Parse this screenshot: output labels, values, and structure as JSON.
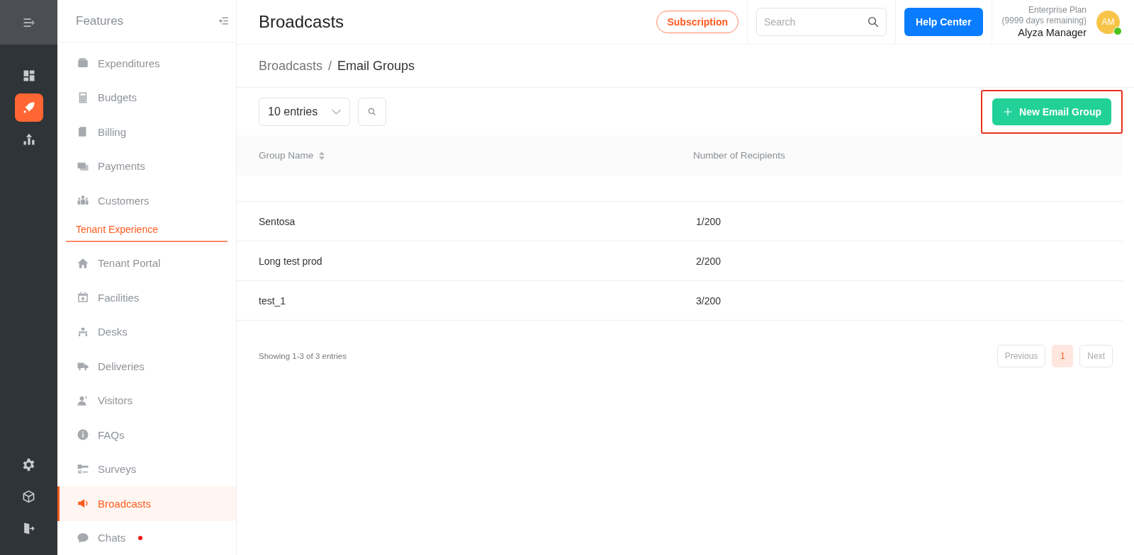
{
  "rail": {
    "items": [
      {
        "selected": false
      },
      {
        "selected": true
      },
      {
        "selected": false
      }
    ],
    "bottom_items": [
      {
        "kind": "settings"
      },
      {
        "kind": "package"
      },
      {
        "kind": "logout"
      }
    ]
  },
  "sidebar": {
    "title": "Features",
    "items": [
      {
        "kind": "item",
        "label": "Expenditures",
        "selected": false,
        "dot": false
      },
      {
        "kind": "item",
        "label": "Budgets",
        "selected": false,
        "dot": false
      },
      {
        "kind": "item",
        "label": "Billing",
        "selected": false,
        "dot": false
      },
      {
        "kind": "item",
        "label": "Payments",
        "selected": false,
        "dot": false
      },
      {
        "kind": "item",
        "label": "Customers",
        "selected": false,
        "dot": false
      },
      {
        "kind": "section",
        "label": "Tenant Experience"
      },
      {
        "kind": "item",
        "label": "Tenant Portal",
        "selected": false,
        "dot": false
      },
      {
        "kind": "item",
        "label": "Facilities",
        "selected": false,
        "dot": false
      },
      {
        "kind": "item",
        "label": "Desks",
        "selected": false,
        "dot": false
      },
      {
        "kind": "item",
        "label": "Deliveries",
        "selected": false,
        "dot": false
      },
      {
        "kind": "item",
        "label": "Visitors",
        "selected": false,
        "dot": false
      },
      {
        "kind": "item",
        "label": "FAQs",
        "selected": false,
        "dot": false
      },
      {
        "kind": "item",
        "label": "Surveys",
        "selected": false,
        "dot": false
      },
      {
        "kind": "item",
        "label": "Broadcasts",
        "selected": true,
        "dot": false
      },
      {
        "kind": "item",
        "label": "Chats",
        "selected": false,
        "dot": true
      }
    ]
  },
  "header": {
    "title": "Broadcasts",
    "subscription": "Subscription",
    "search": {
      "placeholder": "Search"
    },
    "help": "Help Center",
    "plan": "Enterprise Plan",
    "days": "(9999 days remaining)",
    "user": "Alyza Manager",
    "avatar": "AM",
    "online": true
  },
  "breadcrumb": [
    "Broadcasts",
    "/",
    "Email Groups"
  ],
  "toolbar": {
    "entries": "10 entries",
    "new_button": "New Email Group",
    "highlighted": true
  },
  "table": {
    "columns": [
      {
        "label": "Group Name",
        "sortable": true
      },
      {
        "label": "Number of Recipients",
        "sortable": false
      }
    ],
    "rows": [
      [
        "Sentosa",
        "1/200"
      ],
      [
        "Long test prod",
        "2/200"
      ],
      [
        "test_1",
        "3/200"
      ]
    ]
  },
  "footer": {
    "summary": "Showing 1-3 of 3 entries",
    "pages": [
      {
        "label": "Previous",
        "kind": "nav",
        "selected": false
      },
      {
        "label": "1",
        "kind": "page",
        "selected": true
      },
      {
        "label": "Next",
        "kind": "nav",
        "selected": false
      }
    ]
  }
}
